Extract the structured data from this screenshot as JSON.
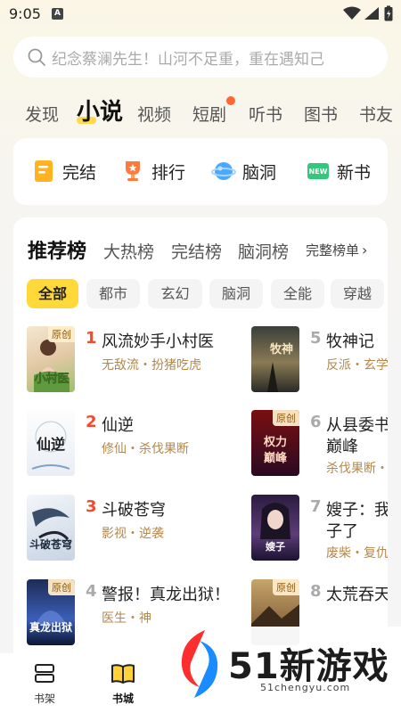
{
  "status_bar": {
    "time": "9:05",
    "notif": "A"
  },
  "search": {
    "placeholder": "纪念蔡澜先生！山河不足重，重在遇知己"
  },
  "top_tabs": [
    "发现",
    "小说",
    "视频",
    "短剧",
    "听书",
    "图书",
    "书友"
  ],
  "top_tab_active": "小说",
  "quick_entries": [
    {
      "label": "完结",
      "icon": "finished-book-icon"
    },
    {
      "label": "排行",
      "icon": "trophy-icon"
    },
    {
      "label": "脑洞",
      "icon": "brain-planet-icon"
    },
    {
      "label": "新书",
      "icon": "new-book-icon"
    }
  ],
  "rank": {
    "tabs": [
      "推荐榜",
      "大热榜",
      "完结榜",
      "脑洞榜"
    ],
    "more": "完整榜单",
    "chips": [
      "全部",
      "都市",
      "玄幻",
      "脑洞",
      "全能",
      "穿越"
    ],
    "books": [
      {
        "rank": "1",
        "title": "风流妙手小村医",
        "tags": "无敌流・扮猪吃虎",
        "badge": "原创"
      },
      {
        "rank": "2",
        "title": "仙逆",
        "tags": "修仙・杀伐果断",
        "badge": ""
      },
      {
        "rank": "3",
        "title": "斗破苍穹",
        "tags": "影视・逆袭",
        "badge": ""
      },
      {
        "rank": "4",
        "title": "警报！真龙出狱！",
        "tags": "医生・神",
        "badge": "原创"
      },
      {
        "rank": "5",
        "title": "牧神记",
        "tags": "反派・玄学",
        "badge": ""
      },
      {
        "rank": "6",
        "title": "从县委书",
        "title2": "巅峰",
        "tags": "杀伐果断・",
        "badge": "原创"
      },
      {
        "rank": "7",
        "title": "嫂子：我",
        "title2": "子了",
        "tags": "废柴・复仇",
        "badge": ""
      },
      {
        "rank": "8",
        "title": "太荒吞天",
        "tags": "",
        "badge": "原创"
      }
    ]
  },
  "bottom_nav": [
    {
      "label": "书架",
      "icon": "bookshelf-icon"
    },
    {
      "label": "书城",
      "icon": "book-city-icon"
    }
  ],
  "watermark": {
    "main": "51新游戏",
    "sub": "51chengyu.com"
  }
}
